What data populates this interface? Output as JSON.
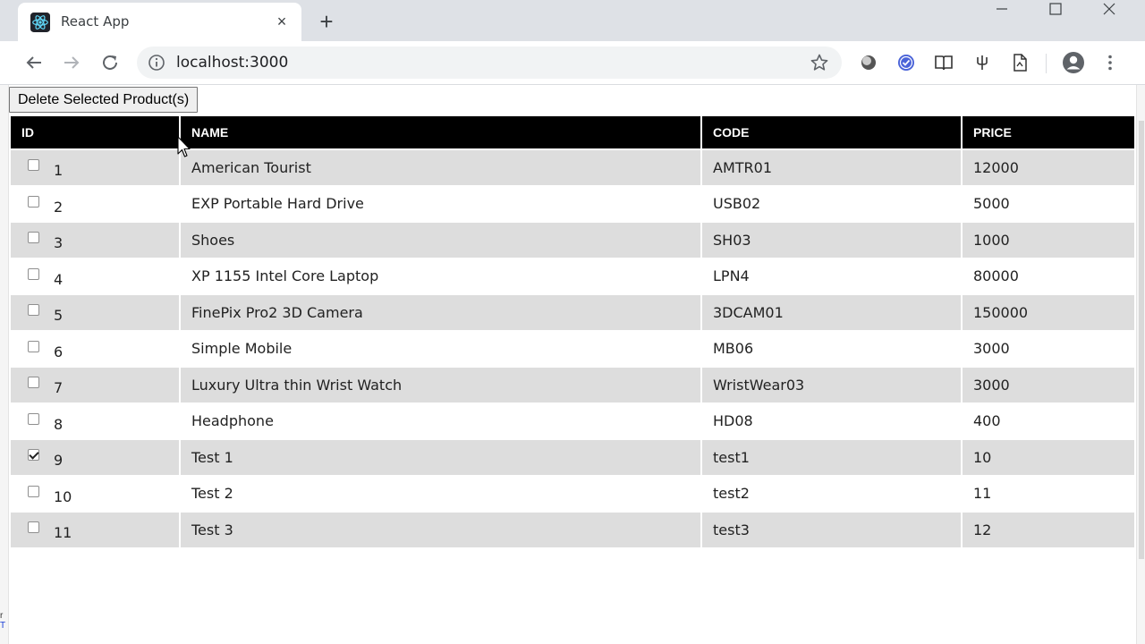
{
  "browser": {
    "tab_title": "React App",
    "tab_close": "×",
    "new_tab": "+",
    "url": "localhost:3000"
  },
  "page": {
    "delete_button_label": "Delete Selected Product(s)",
    "columns": [
      "ID",
      "NAME",
      "CODE",
      "PRICE"
    ],
    "rows": [
      {
        "id": "1",
        "name": "American Tourist",
        "code": "AMTR01",
        "price": "12000",
        "checked": false
      },
      {
        "id": "2",
        "name": "EXP Portable Hard Drive",
        "code": "USB02",
        "price": "5000",
        "checked": false
      },
      {
        "id": "3",
        "name": "Shoes",
        "code": "SH03",
        "price": "1000",
        "checked": false
      },
      {
        "id": "4",
        "name": "XP 1155 Intel Core Laptop",
        "code": "LPN4",
        "price": "80000",
        "checked": false
      },
      {
        "id": "5",
        "name": "FinePix Pro2 3D Camera",
        "code": "3DCAM01",
        "price": "150000",
        "checked": false
      },
      {
        "id": "6",
        "name": "Simple Mobile",
        "code": "MB06",
        "price": "3000",
        "checked": false
      },
      {
        "id": "7",
        "name": "Luxury Ultra thin Wrist Watch",
        "code": "WristWear03",
        "price": "3000",
        "checked": false
      },
      {
        "id": "8",
        "name": "Headphone",
        "code": "HD08",
        "price": "400",
        "checked": false
      },
      {
        "id": "9",
        "name": "Test 1",
        "code": "test1",
        "price": "10",
        "checked": true
      },
      {
        "id": "10",
        "name": "Test 2",
        "code": "test2",
        "price": "11",
        "checked": false
      },
      {
        "id": "11",
        "name": "Test 3",
        "code": "test3",
        "price": "12",
        "checked": false
      }
    ]
  },
  "edge_fragments": [
    "r",
    "T"
  ],
  "colors": {
    "header_bg": "#000000",
    "header_text": "#ffffff",
    "row_odd": "#dddddd",
    "row_even": "#ffffff",
    "react_logo": "#61dafb"
  }
}
